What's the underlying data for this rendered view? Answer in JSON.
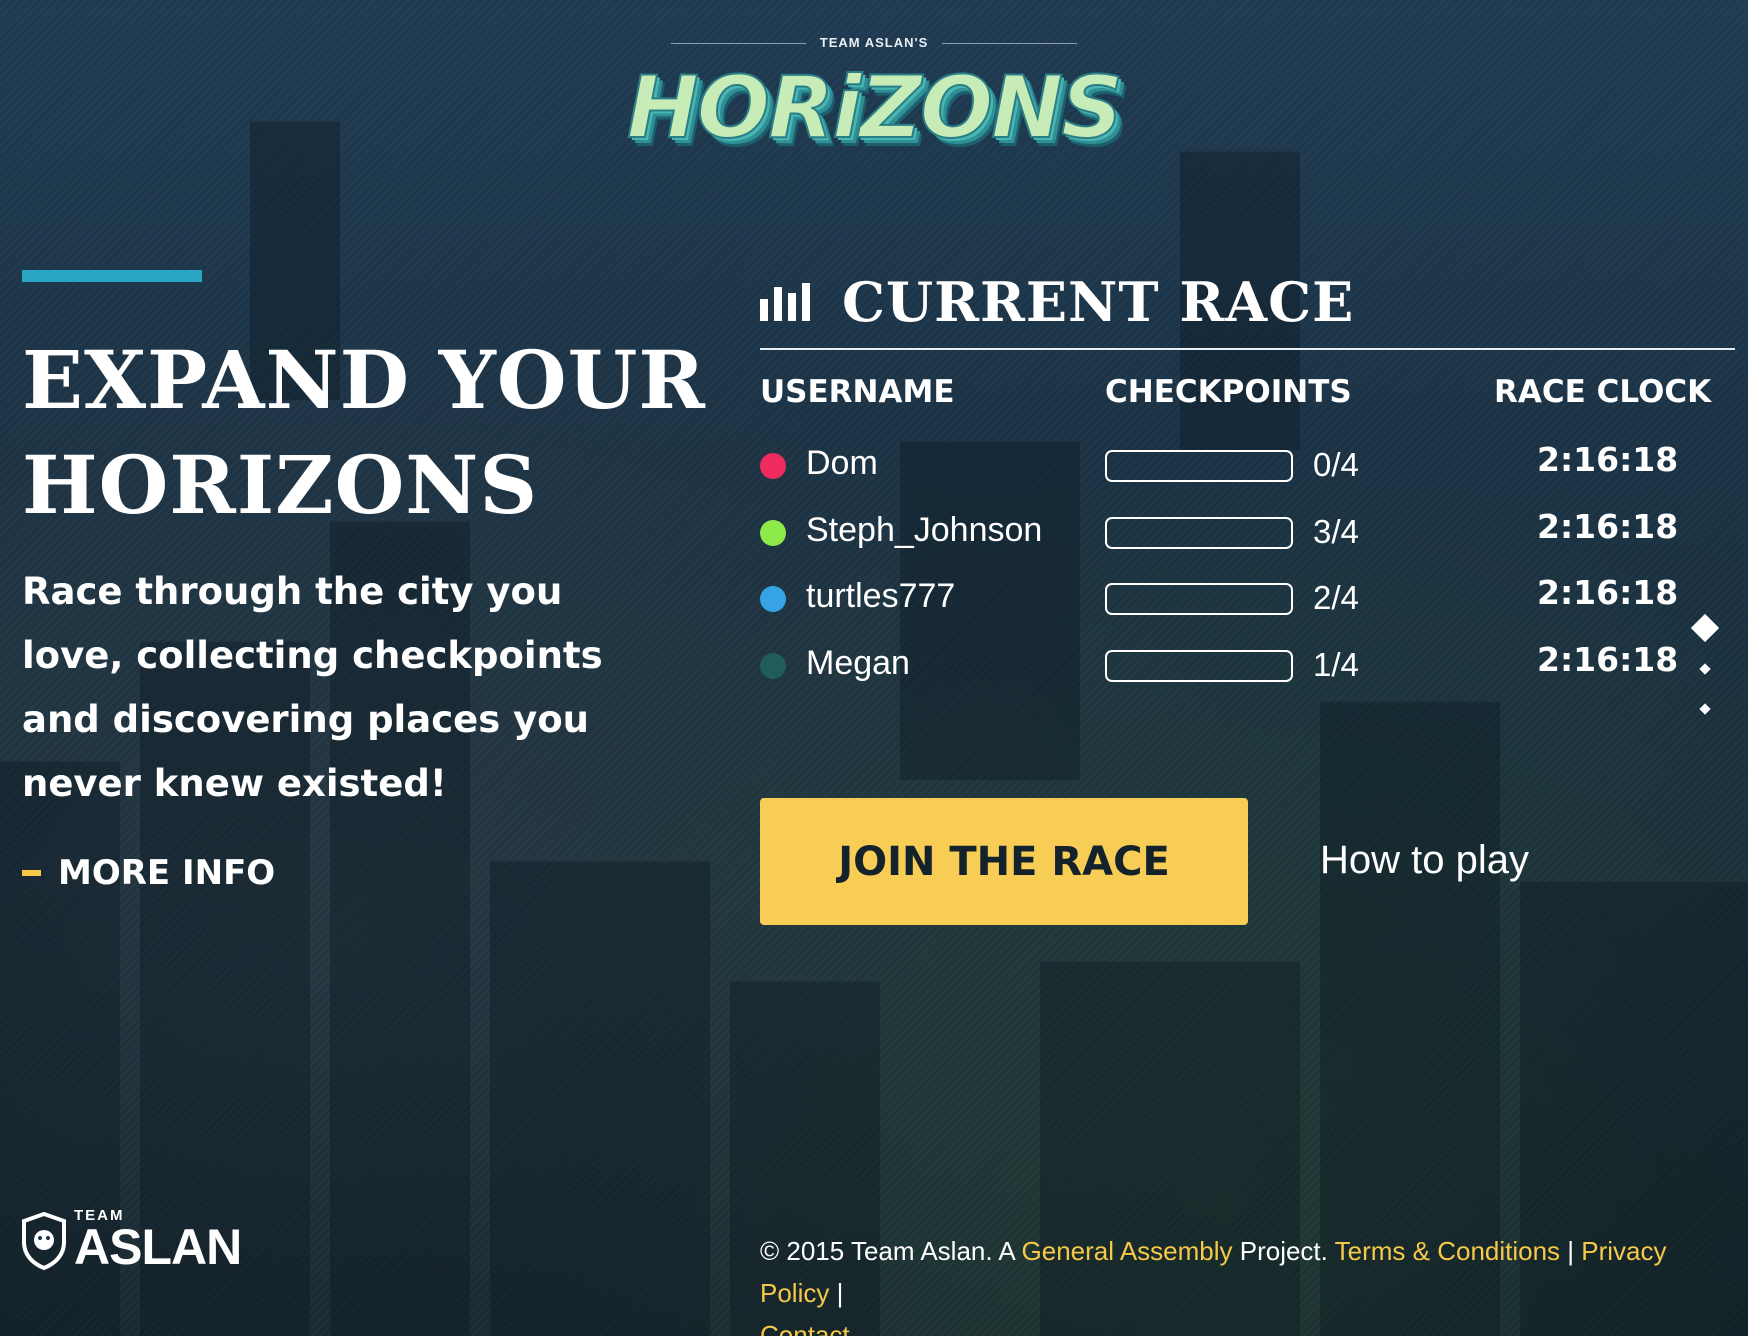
{
  "brand": {
    "top_label": "TEAM ASLAN'S",
    "logo_text": "HORiZONS"
  },
  "hero": {
    "title_line1": "EXPAND YOUR",
    "title_line2": "HORIZONS",
    "description": "Race through the city you love, collecting checkpoints and discovering places you never knew existed!",
    "more_info": "MORE INFO"
  },
  "race": {
    "title": "CURRENT RACE",
    "columns": {
      "username": "USERNAME",
      "checkpoints": "CHECKPOINTS",
      "clock": "RACE CLOCK"
    },
    "racers": [
      {
        "username": "Dom",
        "color": "#ee2a5e",
        "checkpoints": "0/4",
        "progress": 0,
        "clock": "2:16:18"
      },
      {
        "username": "Steph_Johnson",
        "color": "#8ee94a",
        "checkpoints": "3/4",
        "progress": 0.75,
        "clock": "2:16:18"
      },
      {
        "username": "turtles777",
        "color": "#35a3e6",
        "checkpoints": "2/4",
        "progress": 0.5,
        "clock": "2:16:18"
      },
      {
        "username": "Megan",
        "color": "#1f5c5a",
        "checkpoints": "1/4",
        "progress": 0.25,
        "clock": "2:16:18"
      }
    ],
    "join_label": "JOIN THE RACE",
    "how_label": "How to play"
  },
  "team_logo": {
    "small": "TEAM",
    "big": "ASLAN"
  },
  "footer": {
    "copyright": "© 2015 Team Aslan. A ",
    "ga_link": "General Assembly",
    "project": " Project. ",
    "terms": "Terms & Conditions",
    "sep1": " | ",
    "privacy": "Privacy Policy",
    "sep2": " |",
    "contact": "Contact"
  },
  "colors": {
    "accent_yellow": "#f7cd56",
    "accent_teal": "#2aa6c4"
  }
}
